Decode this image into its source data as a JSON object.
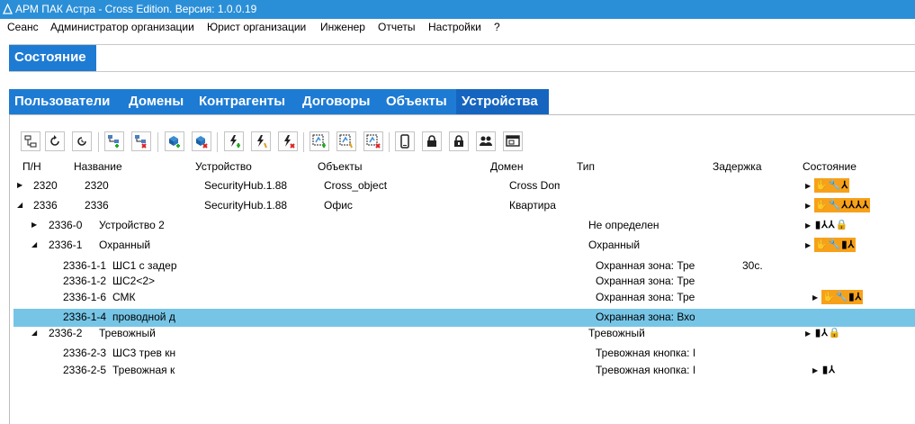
{
  "window": {
    "title": "АРМ ПАК Астра - Cross Edition. Версия: 1.0.0.19"
  },
  "menu": [
    "Сеанс",
    "Администратор организации",
    "Юрист организации",
    "Инженер",
    "Отчеты",
    "Настройки",
    "?"
  ],
  "state_tab": "Состояние",
  "tabs": [
    "Пользователи",
    "Домены",
    "Контрагенты",
    "Договоры",
    "Объекты",
    "Устройства"
  ],
  "active_tab": "Устройства",
  "toolbar": [
    "device-tree-icon",
    "refresh-icon",
    "timer-refresh-icon",
    "add-group-icon",
    "remove-group-icon",
    "add-device-icon",
    "remove-device-icon",
    "add-power-icon",
    "edit-power-icon",
    "remove-power-icon",
    "add-zone-icon",
    "edit-zone-icon",
    "remove-zone-icon",
    "phone-icon",
    "lock-icon",
    "lock-closed-icon",
    "users-icon",
    "window-icon"
  ],
  "columns": [
    "П/Н",
    "Название",
    "Устройство",
    "Объекты",
    "Домен",
    "Тип",
    "Задержка",
    "Состояние"
  ],
  "rows": [
    {
      "pn": "2320",
      "name": "2320",
      "device": "SecurityHub.1.88",
      "object": "Cross_object",
      "domain": "Cross Dom",
      "type": "",
      "delay": "",
      "state": [
        "hand",
        "wrench",
        "net"
      ]
    },
    {
      "pn": "2336",
      "name": "2336",
      "device": "SecurityHub.1.88",
      "object": "Офис",
      "domain": "Квартира",
      "type": "",
      "delay": "",
      "state": [
        "hand",
        "wrench",
        "net",
        "net",
        "net",
        "net"
      ]
    },
    {
      "pn": "2336-0",
      "name": "Устройство 2",
      "device": "",
      "object": "",
      "domain": "",
      "type": "Не определен",
      "delay": "",
      "state": [
        "battery",
        "net",
        "net",
        "lock"
      ]
    },
    {
      "pn": "2336-1",
      "name": "Охранный",
      "device": "",
      "object": "",
      "domain": "",
      "type": "Охранный",
      "delay": "",
      "state": [
        "hand",
        "wrench",
        "battery",
        "net"
      ]
    },
    {
      "pn": "2336-1-1",
      "name": "ШС1 с задер",
      "device": "",
      "object": "",
      "domain": "",
      "type": "Охранная зона: Тре",
      "delay": "30с.",
      "state": []
    },
    {
      "pn": "2336-1-2",
      "name": "ШС2<2>",
      "device": "",
      "object": "",
      "domain": "",
      "type": "Охранная зона: Тре",
      "delay": "",
      "state": []
    },
    {
      "pn": "2336-1-6",
      "name": "СМК",
      "device": "",
      "object": "",
      "domain": "",
      "type": "Охранная зона: Тре",
      "delay": "",
      "state": [
        "hand",
        "wrench",
        "battery",
        "net"
      ]
    },
    {
      "pn": "2336-1-4",
      "name": "проводной д",
      "device": "",
      "object": "",
      "domain": "",
      "type": "Охранная зона: Вхо",
      "delay": "",
      "state": []
    },
    {
      "pn": "2336-2",
      "name": "Тревожный",
      "device": "",
      "object": "",
      "domain": "",
      "type": "Тревожный",
      "delay": "",
      "state": [
        "battery",
        "net",
        "lock"
      ]
    },
    {
      "pn": "2336-2-3",
      "name": "ШС3 трев кн",
      "device": "",
      "object": "",
      "domain": "",
      "type": "Тревожная кнопка: I",
      "delay": "",
      "state": []
    },
    {
      "pn": "2336-2-5",
      "name": "Тревожная к",
      "device": "",
      "object": "",
      "domain": "",
      "type": "Тревожная кнопка: I",
      "delay": "",
      "state": [
        "battery",
        "net"
      ]
    }
  ],
  "selected_row": "2336-1-4",
  "colors": {
    "titlebar": "#2b8fd8",
    "tab": "#1d7bd4",
    "tab_active": "#1565c0",
    "selection": "#76c5e6",
    "state_badge": "#f7a11a"
  }
}
